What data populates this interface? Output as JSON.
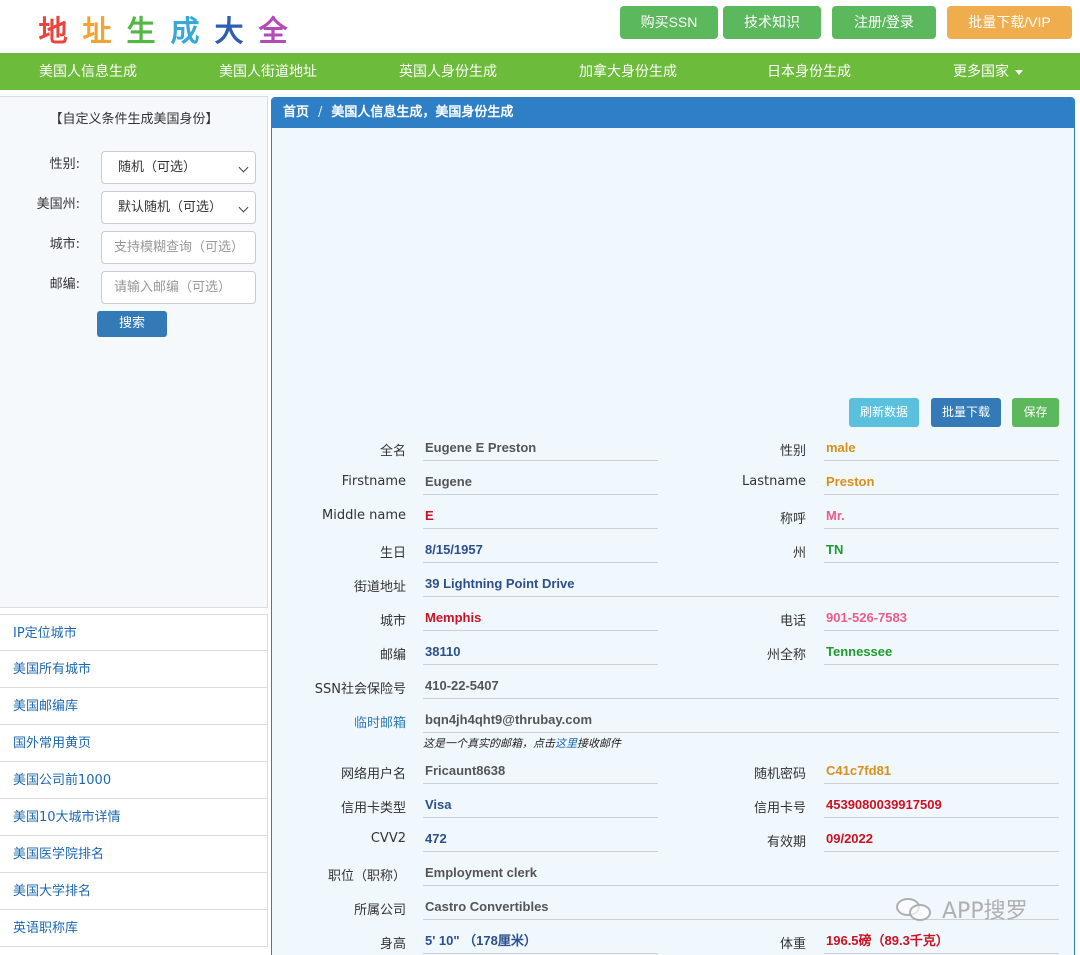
{
  "logo": {
    "chars": [
      {
        "text": "地",
        "color": "#e8453c"
      },
      {
        "text": "址",
        "color": "#f2a431"
      },
      {
        "text": "生",
        "color": "#52b843"
      },
      {
        "text": "成",
        "color": "#39a8d8"
      },
      {
        "text": "大",
        "color": "#2e5db4"
      },
      {
        "text": "全",
        "color": "#b44ab8"
      }
    ]
  },
  "top_buttons": {
    "buy_ssn": "购买SSN",
    "tech": "技术知识",
    "login": "注册/登录",
    "vip": "批量下载/VIP"
  },
  "nav": {
    "us_info": "美国人信息生成",
    "us_street": "美国人街道地址",
    "uk_id": "英国人身份生成",
    "ca_id": "加拿大身份生成",
    "jp_id": "日本身份生成",
    "more": "更多国家"
  },
  "sidebar": {
    "title": "【自定义条件生成美国身份】",
    "gender_label": "性别:",
    "gender_value": "随机（可选）",
    "state_label": "美国州:",
    "state_value": "默认随机（可选）",
    "city_label": "城市:",
    "city_placeholder": "支持模糊查询（可选）",
    "zip_label": "邮编:",
    "zip_placeholder": "请输入邮编（可选）",
    "search": "搜索",
    "links": [
      "IP定位城市",
      "美国所有城市",
      "美国邮编库",
      "国外常用黄页",
      "美国公司前1000",
      "美国10大城市详情",
      "美国医学院排名",
      "美国大学排名",
      "英语职称库"
    ]
  },
  "main": {
    "breadcrumb_home": "首页",
    "breadcrumb_sep": "/",
    "breadcrumb_current": "美国人信息生成，美国身份生成",
    "refresh": "刷新数据",
    "bulk": "批量下载",
    "save": "保存"
  },
  "fields": {
    "fullname_label": "全名",
    "fullname": "Eugene E Preston",
    "gender_label": "性别",
    "gender": "male",
    "firstname_label": "Firstname",
    "firstname": "Eugene",
    "lastname_label": "Lastname",
    "lastname": "Preston",
    "middle_label": "Middle name",
    "middle": "E",
    "title_label": "称呼",
    "title": "Mr.",
    "birthday_label": "生日",
    "birthday": "8/15/1957",
    "state_label": "州",
    "state": "TN",
    "street_label": "街道地址",
    "street": "39 Lightning Point Drive",
    "city_label": "城市",
    "city": "Memphis",
    "phone_label": "电话",
    "phone": "901-526-7583",
    "zip_label": "邮编",
    "zip": "38110",
    "state_full_label": "州全称",
    "state_full": "Tennessee",
    "ssn_label": "SSN社会保险号",
    "ssn": "410-22-5407",
    "tempmail_label": "临时邮箱",
    "tempmail": "bqn4jh4qht9@thrubay.com",
    "tempmail_note_pre": "这是一个真实的邮箱，点击",
    "tempmail_note_link": "这里",
    "tempmail_note_post": "接收邮件",
    "username_label": "网络用户名",
    "username": "Fricaunt8638",
    "password_label": "随机密码",
    "password": "C41c7fd81",
    "cardtype_label": "信用卡类型",
    "cardtype": "Visa",
    "cardno_label": "信用卡号",
    "cardno": "4539080039917509",
    "cvv_label": "CVV2",
    "cvv": "472",
    "expiry_label": "有效期",
    "expiry": "09/2022",
    "job_label": "职位（职称）",
    "job": "Employment clerk",
    "company_label": "所属公司",
    "company": "Castro Convertibles",
    "height_label": "身高",
    "height": "5' 10\" （178厘米）",
    "weight_label": "体重",
    "weight": "196.5磅（89.3千克）"
  },
  "watermark": "APP搜罗"
}
